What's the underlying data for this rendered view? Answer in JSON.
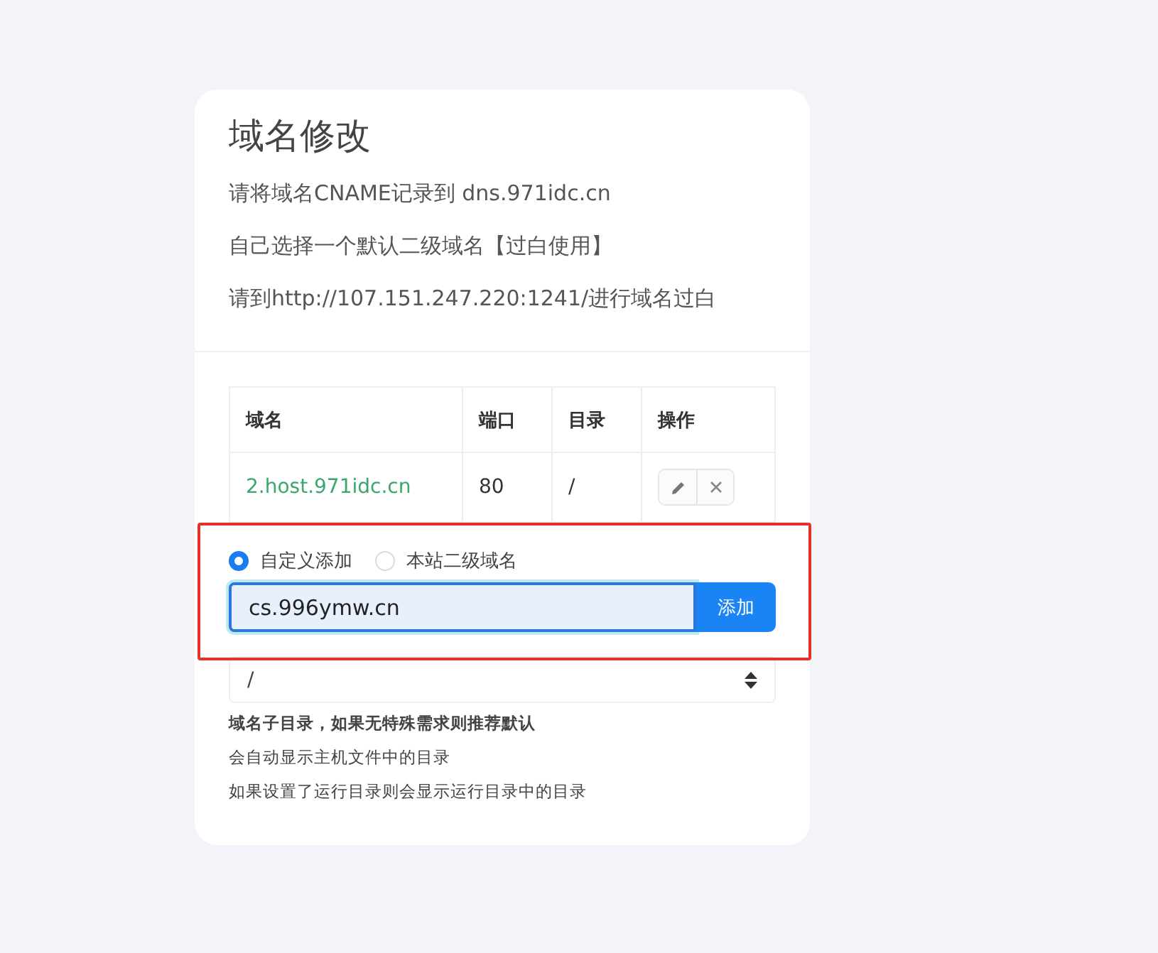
{
  "card": {
    "title": "域名修改",
    "lines": [
      "请将域名CNAME记录到 dns.971idc.cn",
      "自己选择一个默认二级域名【过白使用】",
      "请到http://107.151.247.220:1241/进行域名过白"
    ]
  },
  "table": {
    "columns": [
      "域名",
      "端口",
      "目录",
      "操作"
    ],
    "rows": [
      {
        "domain": "2.host.971idc.cn",
        "port": "80",
        "directory": "/"
      }
    ]
  },
  "radios": [
    {
      "label": "自定义添加",
      "selected": true
    },
    {
      "label": "本站二级域名",
      "selected": false
    }
  ],
  "domain_input": {
    "value": "cs.996ymw.cn",
    "focused": true
  },
  "add_button": "添加",
  "directory_select": {
    "value": "/"
  },
  "notes": [
    {
      "text": "域名子目录，如果无特殊需求则推荐默认",
      "bold": true
    },
    {
      "text": "会自动显示主机文件中的目录",
      "bold": false
    },
    {
      "text": "如果设置了运行目录则会显示运行目录中的目录",
      "bold": false
    }
  ],
  "highlight": true
}
